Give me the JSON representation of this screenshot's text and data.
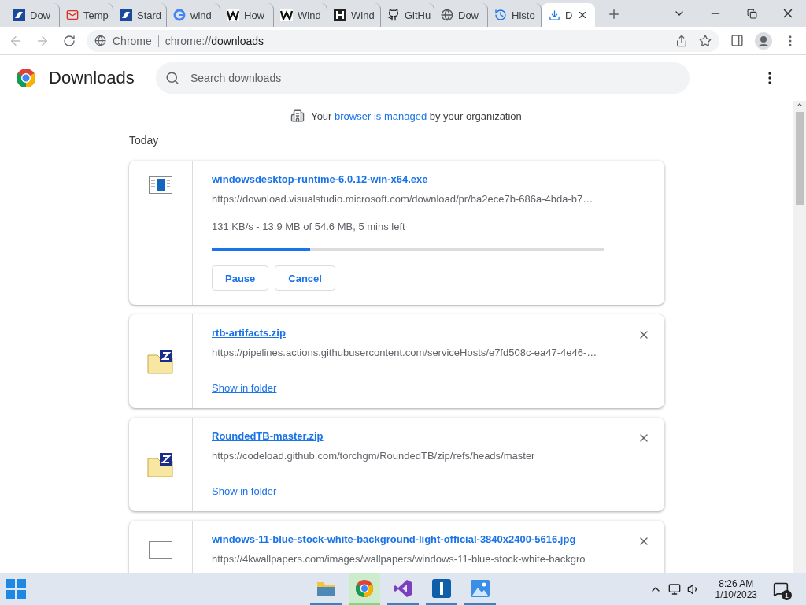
{
  "tabs": [
    {
      "title": "Dow",
      "kind": "bird",
      "selected": false
    },
    {
      "title": "Temp",
      "kind": "mail",
      "selected": false
    },
    {
      "title": "Stard",
      "kind": "bird",
      "selected": false
    },
    {
      "title": "wind",
      "kind": "google",
      "selected": false
    },
    {
      "title": "How",
      "kind": "wiki",
      "selected": false
    },
    {
      "title": "Wind",
      "kind": "wiki",
      "selected": false
    },
    {
      "title": "Wind",
      "kind": "square",
      "selected": false
    },
    {
      "title": "GitHu",
      "kind": "github",
      "selected": false
    },
    {
      "title": "Dow",
      "kind": "globe",
      "selected": false
    },
    {
      "title": "Histo",
      "kind": "history",
      "selected": false
    },
    {
      "title": "D",
      "kind": "download",
      "selected": true
    }
  ],
  "omnibox": {
    "site": "Chrome",
    "url_prefix": "chrome://",
    "url_rest": "downloads"
  },
  "header": {
    "title": "Downloads",
    "search_placeholder": "Search downloads"
  },
  "managed_notice": {
    "before": "Your",
    "link": "browser is managed",
    "after": "by your organization"
  },
  "section": "Today",
  "downloads": [
    {
      "kind": "progress",
      "name": "windowsdesktop-runtime-6.0.12-win-x64.exe",
      "url": "https://download.visualstudio.microsoft.com/download/pr/ba2ece7b-686a-4bda-b7…",
      "status": "131 KB/s - 13.9 MB of 54.6 MB, 5 mins left",
      "level": 0.25,
      "buttons": [
        "Pause",
        "Cancel"
      ]
    },
    {
      "kind": "zip",
      "name": "rtb-artifacts.zip",
      "url": "https://pipelines.actions.githubusercontent.com/serviceHosts/e7fd508c-ea47-4e46-…",
      "action": "Show in folder"
    },
    {
      "kind": "zip",
      "name": "RoundedTB-master.zip",
      "url": "https://codeload.github.com/torchgm/RoundedTB/zip/refs/heads/master",
      "action": "Show in folder"
    },
    {
      "kind": "image",
      "name": "windows-11-blue-stock-white-background-light-official-3840x2400-5616.jpg",
      "url": "https://4kwallpapers.com/images/wallpapers/windows-11-blue-stock-white-backgro"
    }
  ],
  "taskbar": {
    "apps": [
      {
        "kind": "folder",
        "selected": false
      },
      {
        "kind": "chrome",
        "selected": true
      },
      {
        "kind": "vs",
        "selected": false
      },
      {
        "kind": "tile",
        "selected": false
      },
      {
        "kind": "photos",
        "selected": false
      }
    ],
    "time": "8:26 AM",
    "date": "1/10/2023",
    "notifications": "1"
  }
}
